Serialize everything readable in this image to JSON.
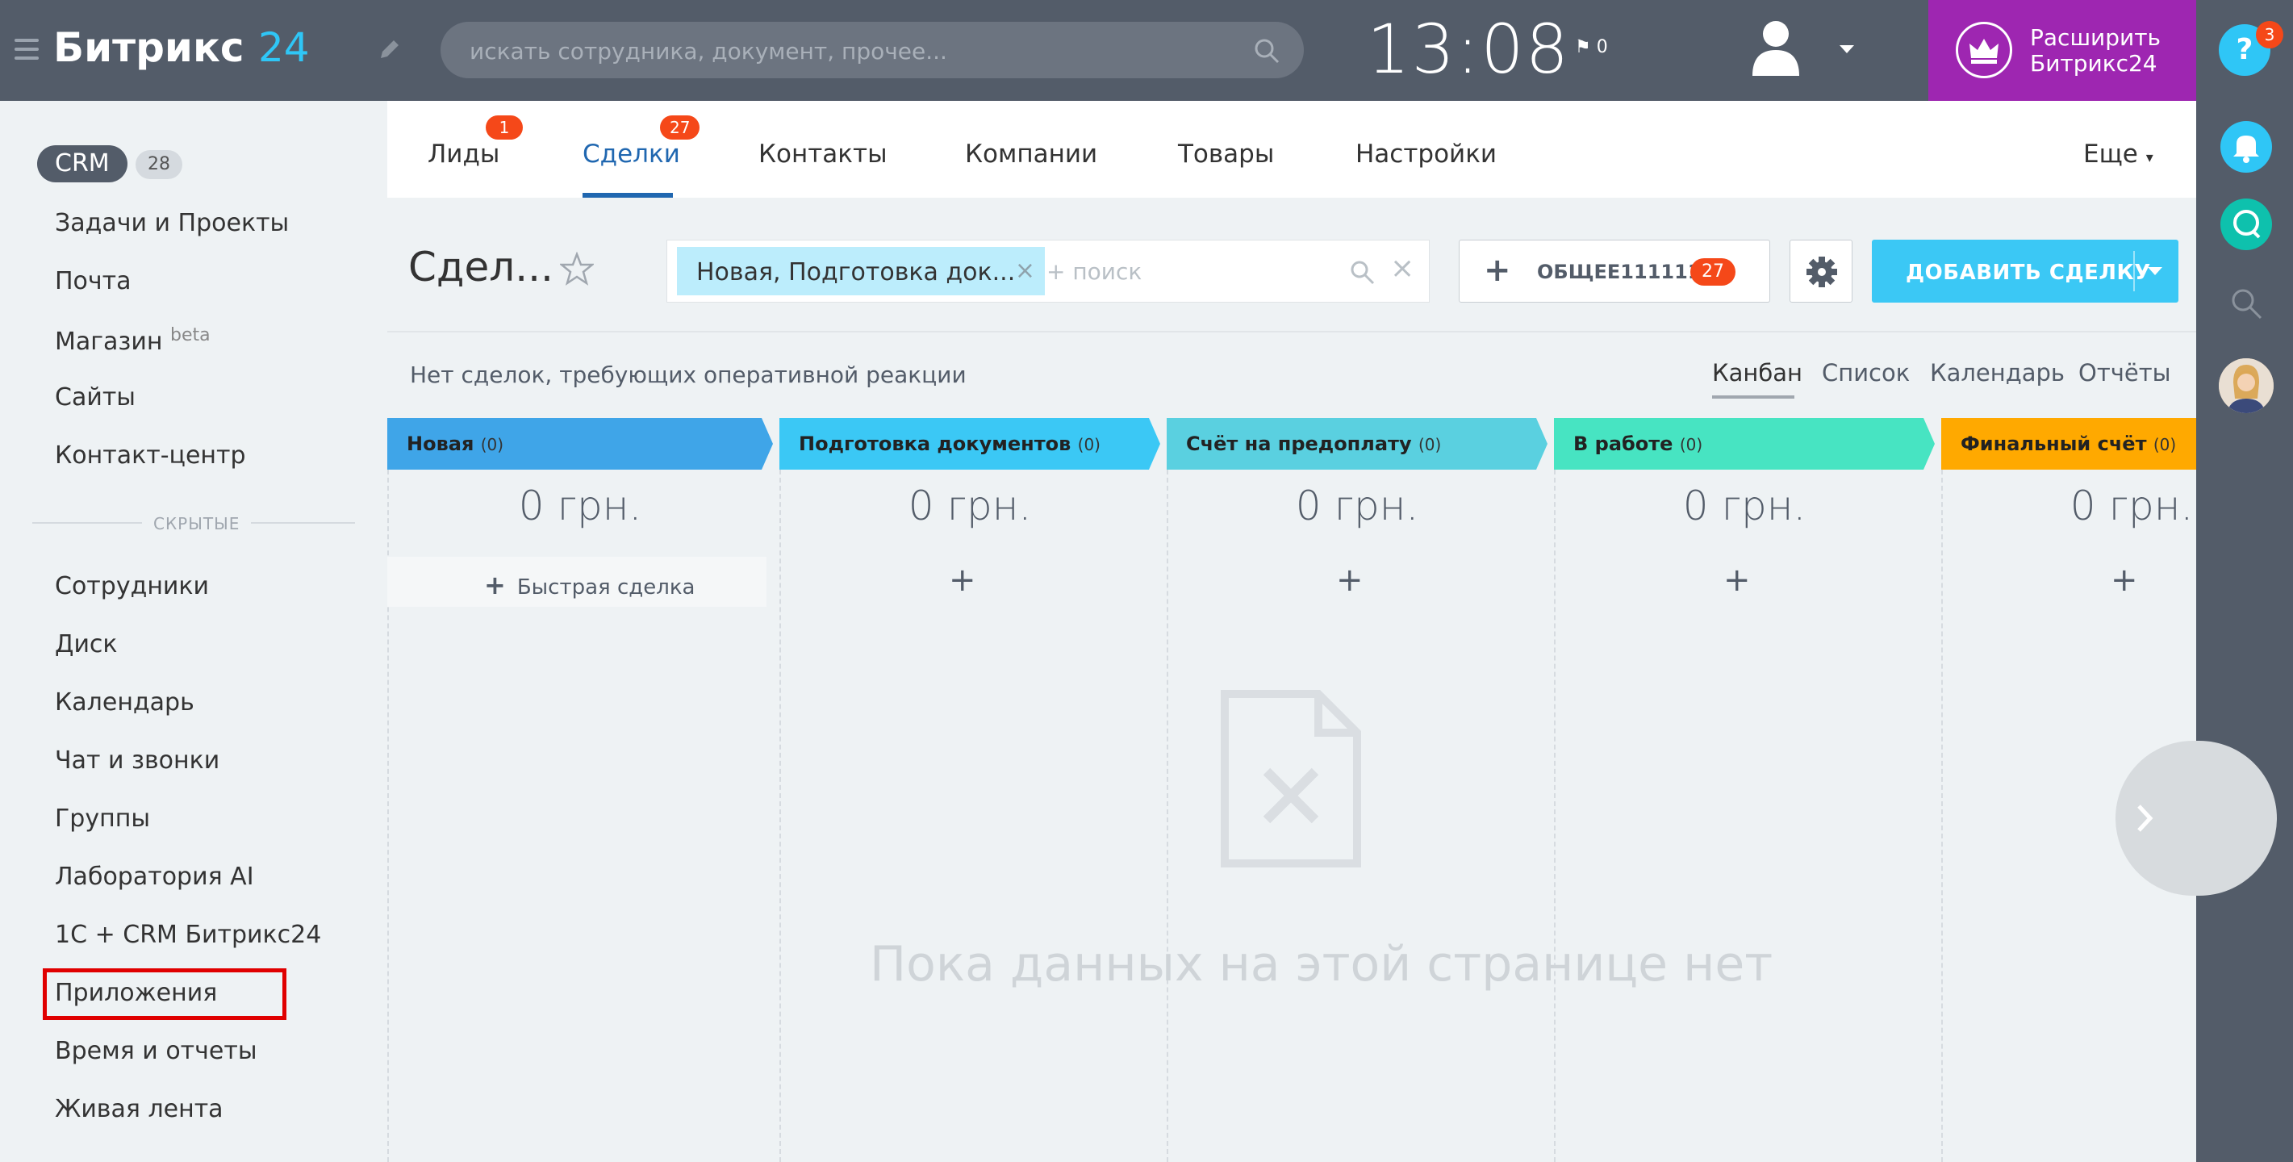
{
  "header": {
    "logo_main": "Битрикс",
    "logo_num": "24",
    "search_placeholder": "искать сотрудника, документ, прочее...",
    "clock": "13:08",
    "flag_count": "0",
    "upgrade_line1": "Расширить",
    "upgrade_line2": "Битрикс24"
  },
  "right_panel": {
    "help_label": "?",
    "help_badge": "3"
  },
  "sidebar": {
    "crm_label": "CRM",
    "crm_count": "28",
    "items_top": [
      "Задачи и Проекты",
      "Почта",
      "Магазин",
      "Сайты",
      "Контакт-центр"
    ],
    "shop_sup": "beta",
    "hidden_label": "СКРЫТЫЕ",
    "items_hidden": [
      "Сотрудники",
      "Диск",
      "Календарь",
      "Чат и звонки",
      "Группы",
      "Лаборатория AI",
      "1С + CRM Битрикс24",
      "Приложения",
      "Время и отчеты",
      "Живая лента"
    ]
  },
  "tabs": {
    "items": [
      "Лиды",
      "Сделки",
      "Контакты",
      "Компании",
      "Товары",
      "Настройки"
    ],
    "leads_badge": "1",
    "deals_badge": "27",
    "more": "Еще"
  },
  "toolbar": {
    "title": "Сдел...",
    "filter_chip": "Новая, Подготовка док...",
    "filter_search": "+ поиск",
    "general_plus": "+",
    "general_label": "ОБЩЕЕ1111111",
    "general_count": "27",
    "add_label": "ДОБАВИТЬ СДЕЛКУ"
  },
  "subbar": {
    "no_deals": "Нет сделок, требующих оперативной реакции",
    "views": [
      "Канбан",
      "Список",
      "Календарь",
      "Отчёты"
    ]
  },
  "kanban": {
    "stages": [
      {
        "name": "Новая",
        "count": "(0)",
        "sum": "0 грн.",
        "color": "#3fa5e8"
      },
      {
        "name": "Подготовка документов",
        "count": "(0)",
        "sum": "0 грн.",
        "color": "#3bc8f5"
      },
      {
        "name": "Счёт на предоплату",
        "count": "(0)",
        "sum": "0 грн.",
        "color": "#5ad0e0"
      },
      {
        "name": "В работе",
        "count": "(0)",
        "sum": "0 грн.",
        "color": "#47e4c2"
      },
      {
        "name": "Финальный счёт",
        "count": "(0)",
        "sum": "0 грн.",
        "color": "#ffa900"
      }
    ],
    "quick_deal": "Быстрая сделка",
    "plus": "+",
    "empty_text": "Пока данных на этой странице нет"
  }
}
